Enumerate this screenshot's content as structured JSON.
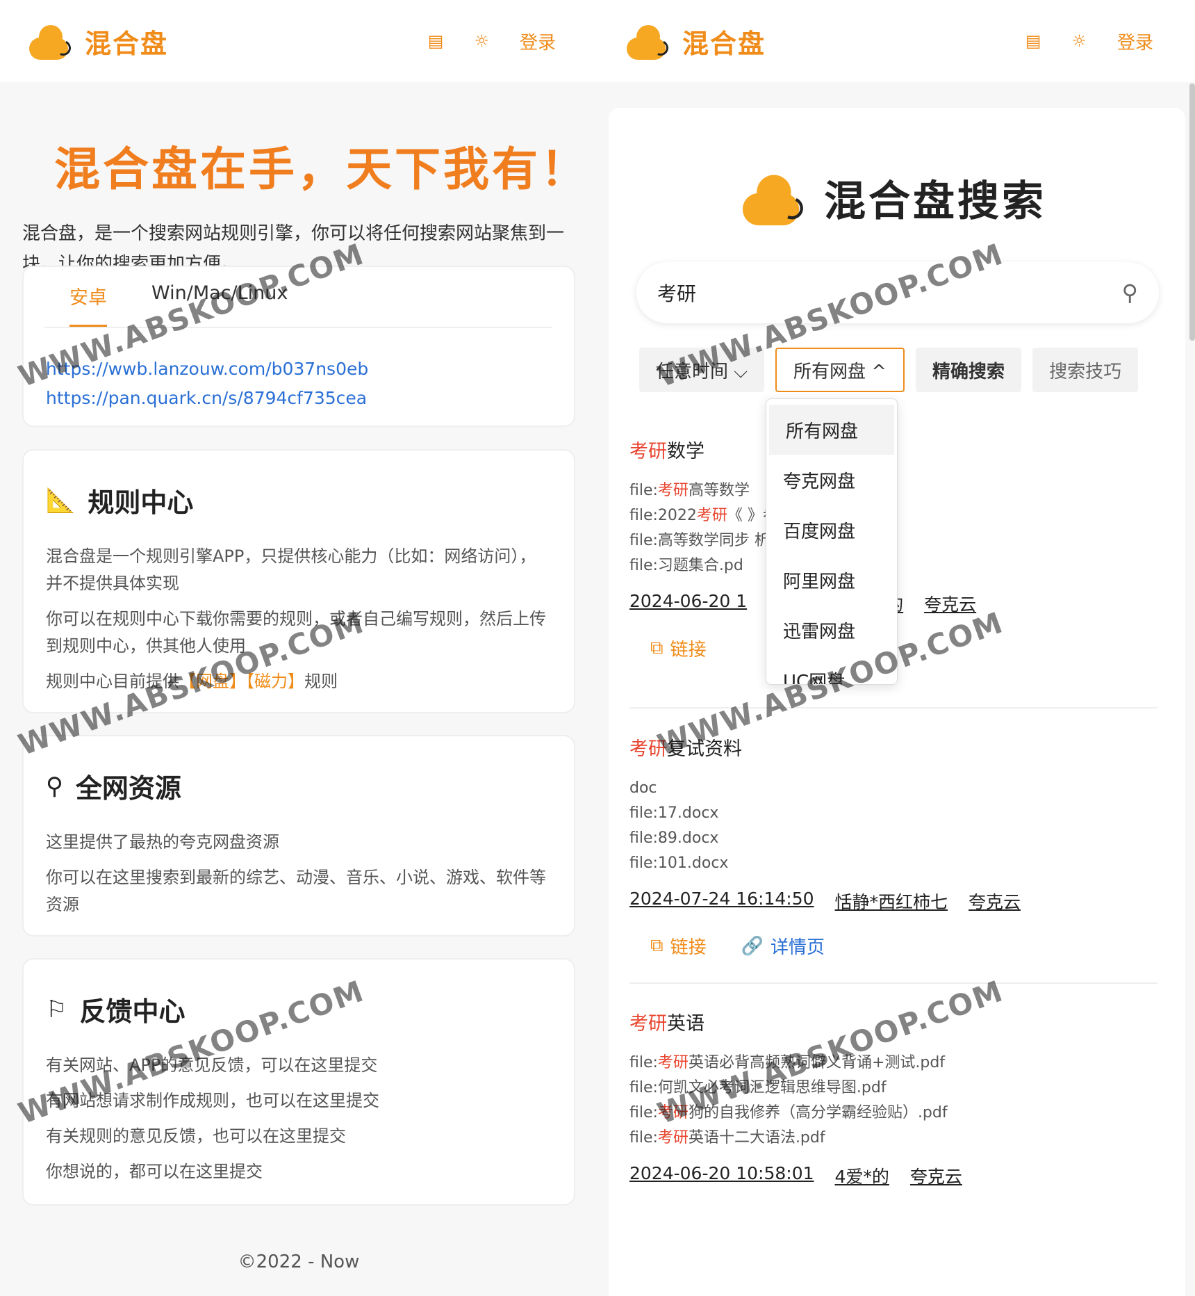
{
  "header": {
    "brand": "混合盘",
    "doc_icon": "▤",
    "theme_icon": "☼",
    "login_label": "登录"
  },
  "hero": {
    "title": "混合盘在手，天下我有！",
    "desc": "混合盘，是一个搜索网站规则引擎，你可以将任何搜索网站聚焦到一块，让你的搜索更加方便。"
  },
  "download": {
    "tabs": [
      "安卓",
      "Win/Mac/Linux"
    ],
    "links": [
      "https://wwb.lanzouw.com/b037ns0eb",
      "https://pan.quark.cn/s/8794cf735cea"
    ]
  },
  "rules": {
    "title": "规则中心",
    "p1": "混合盘是一个规则引擎APP，只提供核心能力（比如：网络访问），并不提供具体实现",
    "p2": "你可以在规则中心下载你需要的规则，或者自己编写规则，然后上传到规则中心，供其他人使用",
    "p3_prefix": "规则中心目前提供",
    "p3_tag1": "【网盘】",
    "p3_tag2": "【磁力】",
    "p3_suffix": "规则"
  },
  "resources": {
    "title": "全网资源",
    "p1": "这里提供了最热的夸克网盘资源",
    "p2": "你可以在这里搜索到最新的综艺、动漫、音乐、小说、游戏、软件等资源"
  },
  "feedback": {
    "title": "反馈中心",
    "items": [
      "有关网站、APP的意见反馈，可以在这里提交",
      "有网站想请求制作成规则，也可以在这里提交",
      "有关规则的意见反馈，也可以在这里提交",
      "你想说的，都可以在这里提交"
    ]
  },
  "footer": "©2022 - Now",
  "search": {
    "title": "混合盘搜索",
    "query": "考研",
    "filters": {
      "time": "任意时间 ⌵",
      "disk": "所有网盘 ^",
      "exact": "精确搜索",
      "tips": "搜索技巧"
    },
    "dropdown": [
      "所有网盘",
      "夸克网盘",
      "百度网盘",
      "阿里网盘",
      "迅雷网盘",
      "UC网盘"
    ]
  },
  "results": [
    {
      "kw": "考研",
      "title_rest": "数学",
      "files": [
        {
          "pre": "file:",
          "kw": "考研",
          "post": "高等数学"
        },
        {
          "pre": "file:2022",
          "kw": "考研",
          "post": "《                              》参考答案.pdf"
        },
        {
          "pre": "file:高等数学同步",
          "kw": "",
          "post": "                              析分册.pdf"
        },
        {
          "pre": "file:习题集合.pd",
          "kw": "",
          "post": ""
        }
      ],
      "date": "2024-06-20 1",
      "user": "的",
      "source": "夸克云",
      "link_label": "链接"
    },
    {
      "kw": "考研",
      "title_rest": "复试资料",
      "files": [
        {
          "pre": "doc",
          "kw": "",
          "post": ""
        },
        {
          "pre": "file:17.docx",
          "kw": "",
          "post": ""
        },
        {
          "pre": "file:89.docx",
          "kw": "",
          "post": ""
        },
        {
          "pre": "file:101.docx",
          "kw": "",
          "post": ""
        }
      ],
      "date": "2024-07-24 16:14:50",
      "user": "恬静*西红柿七",
      "source": "夸克云",
      "link_label": "链接",
      "detail_label": "详情页"
    },
    {
      "kw": "考研",
      "title_rest": "英语",
      "files": [
        {
          "pre": "file:",
          "kw": "考研",
          "post": "英语必背高频熟词僻义背诵+测试.pdf"
        },
        {
          "pre": "file:何凯文必考词汇逻辑思维导图.pdf",
          "kw": "",
          "post": ""
        },
        {
          "pre": "file:",
          "kw": "考研",
          "post": "狗的自我修养（高分学霸经验贴）.pdf"
        },
        {
          "pre": "file:",
          "kw": "考研",
          "post": "英语十二大语法.pdf"
        }
      ],
      "date": "2024-06-20 10:58:01",
      "user": "4爱*的",
      "source": "夸克云"
    }
  ],
  "watermark": "WWW.ABSKOOP.COM",
  "colors": {
    "accent": "#f08c1a",
    "keyword": "#e8442e",
    "link": "#2a6fd6"
  }
}
